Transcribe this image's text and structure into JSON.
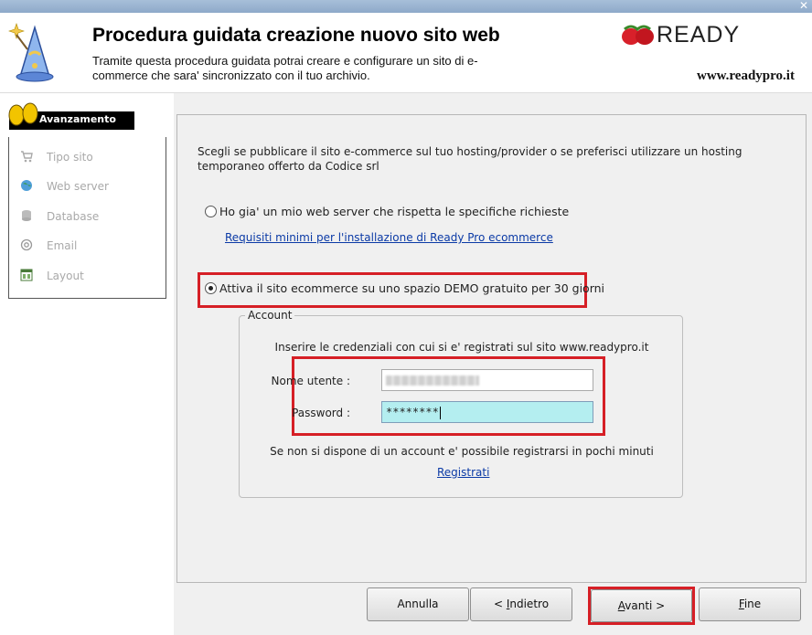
{
  "window": {
    "close_glyph": "✕"
  },
  "header": {
    "title": "Procedura guidata creazione nuovo sito web",
    "subtitle": "Tramite questa procedura guidata potrai creare e configurare un sito di e-commerce che sara' sincronizzato con il tuo archivio.",
    "logo_text": "READY",
    "website": "www.readypro.it"
  },
  "sidebar": {
    "progress_label": "Avanzamento",
    "steps": [
      {
        "label": "Tipo sito",
        "icon": "cart-icon"
      },
      {
        "label": "Web server",
        "icon": "globe-icon"
      },
      {
        "label": "Database",
        "icon": "database-icon"
      },
      {
        "label": "Email",
        "icon": "at-sign-icon"
      },
      {
        "label": "Layout",
        "icon": "layout-icon"
      }
    ]
  },
  "main": {
    "intro": "Scegli se pubblicare il sito e-commerce sul tuo hosting/provider o se preferisci utilizzare un hosting temporaneo offerto da Codice srl",
    "option_own_server": "Ho gia' un mio web server che rispetta le specifiche richieste",
    "requirements_link": "Requisiti minimi per l'installazione di Ready Pro ecommerce",
    "option_demo": "Attiva il sito ecommerce su uno spazio DEMO gratuito per 30 giorni",
    "selected_option": "demo",
    "account": {
      "group_title": "Account",
      "info": "Inserire le credenziali con cui si e' registrati sul sito www.readypro.it",
      "username_label": "Nome utente :",
      "password_label": "Password :",
      "password_value": "********",
      "register_info": "Se non si dispone di un account e' possibile registrarsi in pochi minuti",
      "register_link": "Registrati"
    }
  },
  "buttons": {
    "cancel": "Annulla",
    "back_prefix": "< ",
    "back_mnemonic": "I",
    "back_rest": "ndietro",
    "next_mnemonic": "A",
    "next_rest": "vanti >",
    "finish_mnemonic": "F",
    "finish_rest": "ine"
  },
  "colors": {
    "highlight": "#d61f26",
    "focused_input": "#b4eef0",
    "link": "#0b3aa6"
  }
}
